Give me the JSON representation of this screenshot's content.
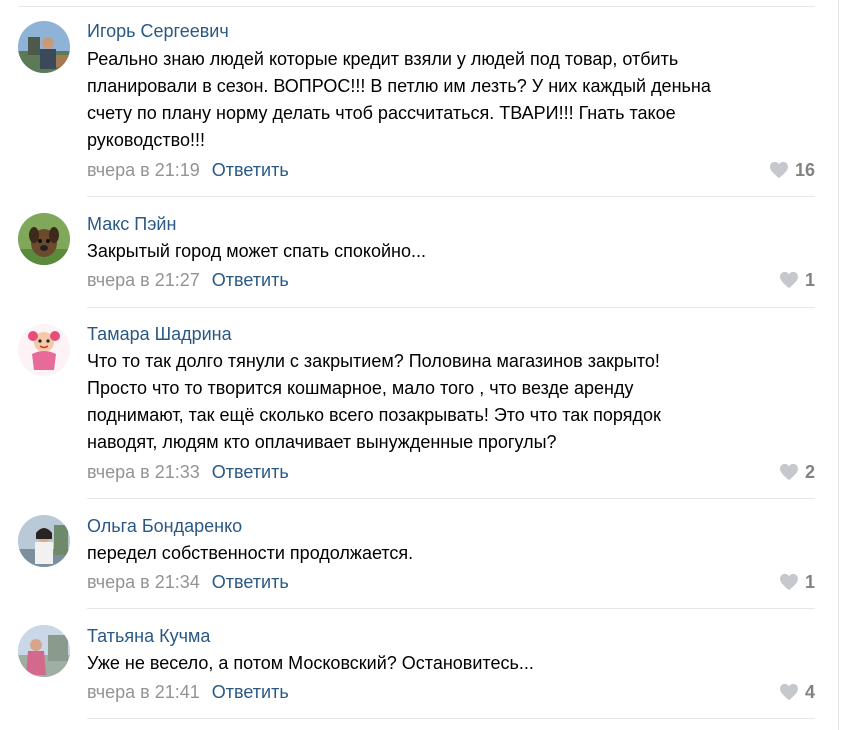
{
  "comments": [
    {
      "author": "Игорь Сергеевич",
      "text": "Реально знаю людей которые кредит взяли у людей под товар, отбить\nпланировали в сезон. ВОПРОС!!! В петлю им лезть? У них каждый деньна\nсчету по плану норму делать чтоб рассчитаться. ТВАРИ!!! Гнать такое\nруководство!!!",
      "date": "вчера в 21:19",
      "reply": "Ответить",
      "likes": "16"
    },
    {
      "author": "Макс Пэйн",
      "text": "Закрытый город может спать спокойно...",
      "date": "вчера в 21:27",
      "reply": "Ответить",
      "likes": "1"
    },
    {
      "author": "Тамара Шадрина",
      "text": "Что то так долго тянули с закрытием? Половина магазинов закрыто!\nПросто что то творится кошмарное, мало того , что везде аренду\nподнимают, так ещё сколько всего позакрывать! Это что так порядок\nнаводят, людям кто оплачивает вынужденные прогулы?",
      "date": "вчера в 21:33",
      "reply": "Ответить",
      "likes": "2"
    },
    {
      "author": "Ольга Бондаренко",
      "text": "передел собственности продолжается.",
      "date": "вчера в 21:34",
      "reply": "Ответить",
      "likes": "1"
    },
    {
      "author": "Татьяна Кучма",
      "text": "Уже не весело, а потом Московский? Остановитесь...",
      "date": "вчера в 21:41",
      "reply": "Ответить",
      "likes": "4"
    }
  ],
  "icons": {
    "like": "heart-icon"
  },
  "colors": {
    "author_link": "#2a5885",
    "meta_gray": "#939393",
    "like_gray": "#828282",
    "divider": "#e7e8ec"
  }
}
